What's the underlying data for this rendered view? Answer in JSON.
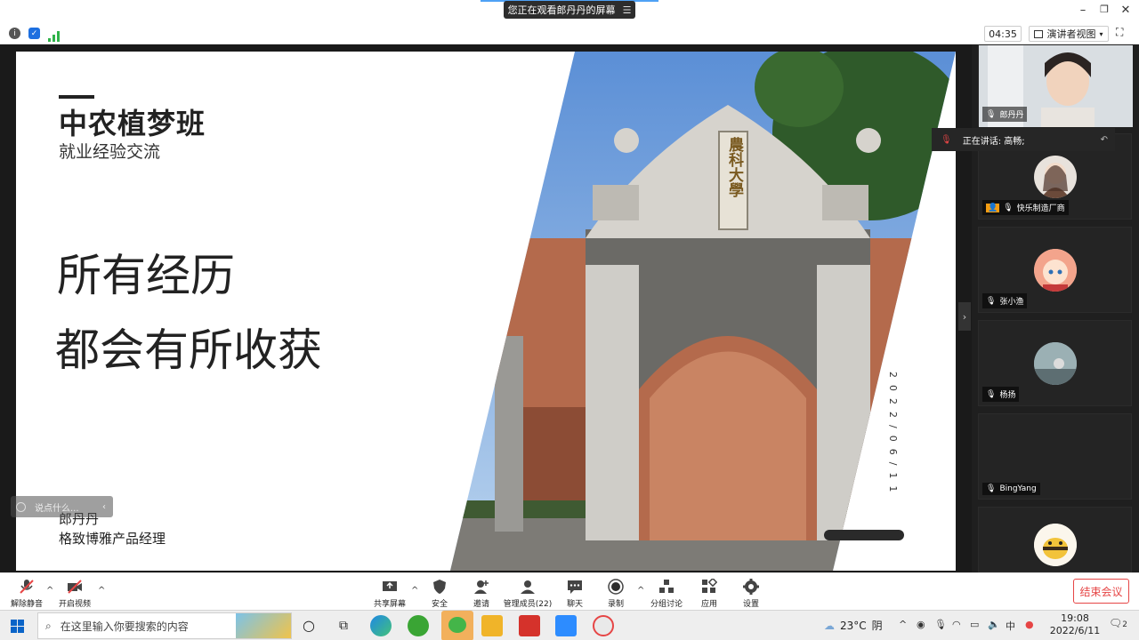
{
  "share_banner": {
    "text": "您正在观看郎丹丹的屏幕",
    "menu_icon": "menu-icon"
  },
  "toolbar": {
    "timer": "04:35",
    "view_label": "演讲者视图"
  },
  "slide": {
    "brand": "中农植梦班",
    "subtitle": "就业经验交流",
    "headline_1": "所有经历",
    "headline_2": "都会有所收获",
    "speaker_name": "郎丹丹",
    "speaker_role": "格致博雅产品经理",
    "date_vertical": "2022/06/11",
    "gate_plaque": "農科大學"
  },
  "chat_hint": "说点什么...",
  "gallery": {
    "speaking": "正在讲话: 高畅;",
    "tiles": [
      {
        "name": "郎丹丹"
      },
      {
        "name": "快乐制造厂商"
      },
      {
        "name": "张小渔"
      },
      {
        "name": "杨扬"
      },
      {
        "name": "BingYang"
      }
    ]
  },
  "controls": {
    "unmute": "解除静音",
    "start_video": "开启视频",
    "share_screen": "共享屏幕",
    "security": "安全",
    "invite": "邀请",
    "participants": "管理成员(22)",
    "chat": "聊天",
    "record": "录制",
    "breakout": "分组讨论",
    "apps": "应用",
    "settings": "设置",
    "end_meeting": "结束会议"
  },
  "taskbar": {
    "search_placeholder": "在这里输入你要搜索的内容",
    "temperature": "23°C",
    "weather": "阴",
    "time": "19:08",
    "date": "2022/6/11",
    "notification_count": "2"
  },
  "colors": {
    "accent": "#4ea1f5",
    "end_meeting": "#e64545",
    "record": "#2b2b2b"
  }
}
